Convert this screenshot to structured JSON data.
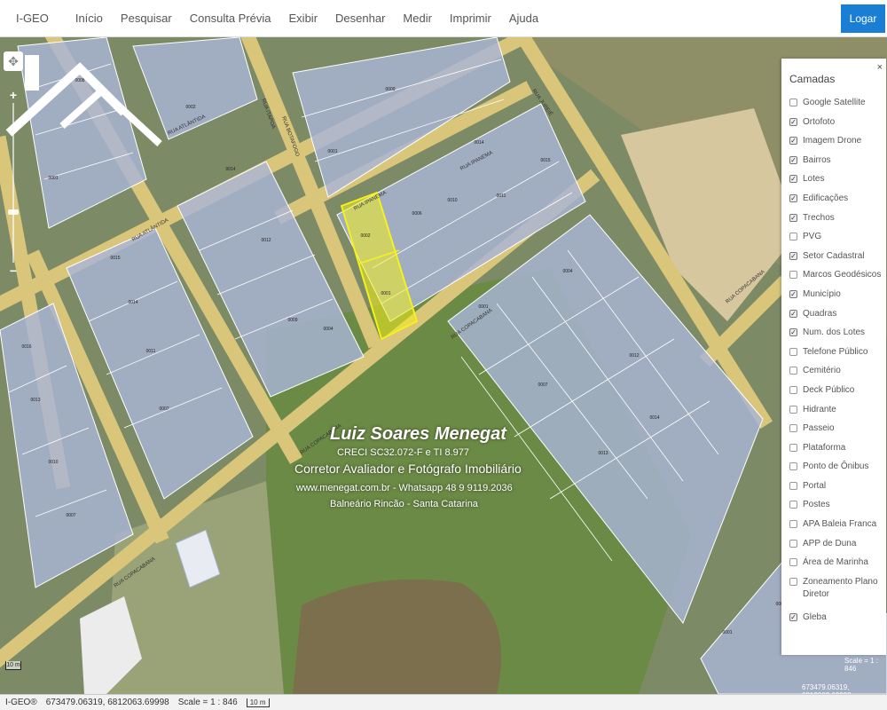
{
  "app": {
    "brand": "I-GEO"
  },
  "nav": {
    "items": [
      "Início",
      "Pesquisar",
      "Consulta Prévia",
      "Exibir",
      "Desenhar",
      "Medir",
      "Imprimir",
      "Ajuda"
    ],
    "login_label": "Logar"
  },
  "map": {
    "pan_glyph": "✥",
    "zoom_in_glyph": "+",
    "zoom_out_glyph": "−",
    "scale_overlay": "Scale = 1 : 846",
    "coords_overlay": "673479.06319, 6812063.69998",
    "scalebar_label": "10 m",
    "street_labels": [
      "RUA ATLÂNTIDA",
      "RUA ITAPOÁ",
      "RUA BOTAFOGO",
      "RUA IPANEMA",
      "RUA COPACABANA",
      "RUA JUREIÊ"
    ],
    "lot_labels": [
      "0001",
      "0002",
      "0003",
      "0004",
      "0005",
      "0006",
      "0007",
      "0008",
      "0009",
      "0010",
      "0011",
      "0012",
      "0013",
      "0014",
      "0015",
      "0016"
    ]
  },
  "watermark": {
    "name": "Luiz Soares Menegat",
    "creci": "CRECI SC32.072-F e TI 8.977",
    "role": "Corretor Avaliador e Fotógrafo Imobiliário",
    "contact": "www.menegat.com.br - Whatsapp 48 9 9119.2036",
    "location": "Balneário Rincão - Santa Catarina"
  },
  "layers": {
    "title": "Camadas",
    "close_glyph": "×",
    "items": [
      {
        "label": "Google Satellite",
        "checked": false
      },
      {
        "label": "Ortofoto",
        "checked": true
      },
      {
        "label": "Imagem Drone",
        "checked": true
      },
      {
        "label": "Bairros",
        "checked": true
      },
      {
        "label": "Lotes",
        "checked": true
      },
      {
        "label": "Edificações",
        "checked": true
      },
      {
        "label": "Trechos",
        "checked": true
      },
      {
        "label": "PVG",
        "checked": false
      },
      {
        "label": "Setor Cadastral",
        "checked": true
      },
      {
        "label": "Marcos Geodésicos",
        "checked": false
      },
      {
        "label": "Município",
        "checked": true
      },
      {
        "label": "Quadras",
        "checked": true
      },
      {
        "label": "Num. dos Lotes",
        "checked": true
      },
      {
        "label": "Telefone Público",
        "checked": false
      },
      {
        "label": "Cemitério",
        "checked": false
      },
      {
        "label": "Deck Público",
        "checked": false
      },
      {
        "label": "Hidrante",
        "checked": false
      },
      {
        "label": "Passeio",
        "checked": false
      },
      {
        "label": "Plataforma",
        "checked": false
      },
      {
        "label": "Ponto de Ônibus",
        "checked": false
      },
      {
        "label": "Portal",
        "checked": false
      },
      {
        "label": "Postes",
        "checked": false
      },
      {
        "label": "APA Baleia Franca",
        "checked": false
      },
      {
        "label": "APP de Duna",
        "checked": false
      },
      {
        "label": "Área de Marinha",
        "checked": false
      },
      {
        "label": "Zoneamento Plano Diretor",
        "checked": false
      },
      {
        "label": "Gleba",
        "checked": true
      }
    ]
  },
  "status": {
    "brand": "I-GEO®",
    "coords": "673479.06319, 6812063.69998",
    "scale": "Scale = 1 : 846",
    "scalebar": "10 m"
  },
  "colors": {
    "road": "#d9c67a",
    "lot_fill": "#a9b4d6",
    "lot_stroke": "#ffffff",
    "selected_lot": "#f4f11c",
    "vegetation": "#6f8a4e",
    "sand": "#d8c8a0",
    "water": "#7a6e4e",
    "login_button": "#1a7fd4"
  }
}
